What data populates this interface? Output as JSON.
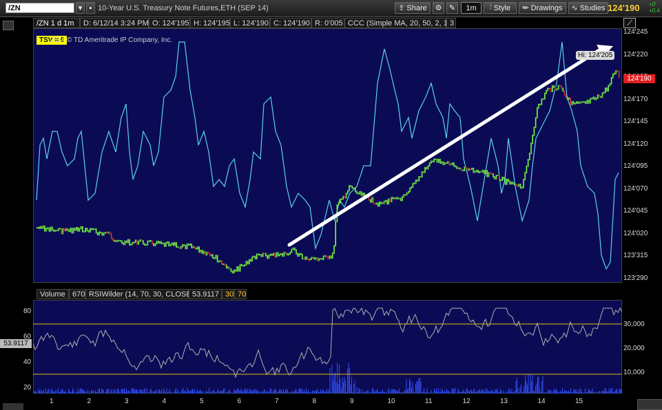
{
  "toolbar": {
    "symbol": "/ZN",
    "description": "10-Year U.S. Treasury Note Futures,ETH (SEP 14)",
    "share_label": "Share",
    "interval_label": "1m",
    "style_label": "Style",
    "drawings_label": "Drawings",
    "studies_label": "Studies",
    "last_price": "124'190",
    "change_1": "+0'",
    "change_2": "+0.4"
  },
  "info_bar": {
    "symbol_period": "/ZN 1 d 1m",
    "datetime": "D: 6/12/14 3:24 PM",
    "open": "O: 124'195",
    "high": "H: 124'195",
    "low": "L: 124'190",
    "close": "C: 124'190",
    "range": "R: 0'005",
    "study": "CCC (Simple MA, 20, 50, 2, 1)",
    "study_value": "3"
  },
  "price_panel": {
    "tsv_label": "TSV = 0",
    "copyright": "2014 © TD Ameritrade IP Company, Inc.",
    "hi_label": "Hi: 124'205",
    "current_price_tag": "124'190",
    "price_ticks": [
      "124'245",
      "124'220",
      "124'195",
      "124'170",
      "124'145",
      "124'120",
      "124'095",
      "124'070",
      "124'045",
      "124'020",
      "123'315",
      "123'290"
    ]
  },
  "lower_panel": {
    "volume_label": "Volume",
    "volume_value": "670",
    "rsi_label": "RSIWilder (14, 70, 30, CLOSE)",
    "rsi_value": "53.9117",
    "rsi_low": "30",
    "rsi_high": "70",
    "rsi_tag": "53.9117",
    "rsi_ticks": [
      "80",
      "60",
      "40",
      "20"
    ],
    "volume_ticks": [
      "30,000",
      "20,000",
      "10,000"
    ]
  },
  "x_axis": {
    "ticks": [
      "1",
      "2",
      "3",
      "4",
      "5",
      "6",
      "7",
      "8",
      "9",
      "10",
      "11",
      "12",
      "13",
      "14",
      "15"
    ]
  },
  "colors": {
    "panel_bg": "#0b0b55",
    "cyan_line": "#5ad2f0",
    "up_bar": "#7cfc40",
    "down_bar": "#e03030",
    "rsi_line": "#b0b0b0",
    "rsi_level": "#e0c000",
    "volume": "#3050ff",
    "arrow": "#ffffff"
  }
}
